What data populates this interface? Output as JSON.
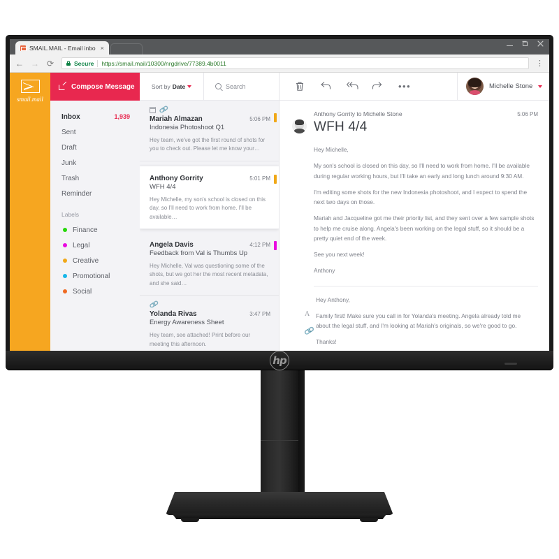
{
  "browser": {
    "tab_title": "SMAIL.MAIL - Email inbo",
    "tab_close": "×",
    "secure_label": "Secure",
    "url": "https://smail.mail/10300/nrgdrive/77389.4b0011",
    "back_icon": "←",
    "forward_icon": "→",
    "reload_icon": "⟳",
    "menu_icon": "⋮"
  },
  "brand": {
    "name": "smail.mail"
  },
  "nav": {
    "compose_label": "Compose Message",
    "items": [
      {
        "label": "Inbox",
        "count": "1,939",
        "active": true
      },
      {
        "label": "Sent",
        "count": "",
        "active": false
      },
      {
        "label": "Draft",
        "count": "",
        "active": false
      },
      {
        "label": "Junk",
        "count": "",
        "active": false
      },
      {
        "label": "Trash",
        "count": "",
        "active": false
      },
      {
        "label": "Reminder",
        "count": "",
        "active": false
      }
    ],
    "labels_header": "Labels",
    "labels": [
      {
        "label": "Finance",
        "color": "#27d70a"
      },
      {
        "label": "Legal",
        "color": "#e90ae0"
      },
      {
        "label": "Creative",
        "color": "#f0a818"
      },
      {
        "label": "Promotional",
        "color": "#17b6e8"
      },
      {
        "label": "Social",
        "color": "#ef6a22"
      }
    ]
  },
  "list_toolbar": {
    "sort_prefix": "Sort by ",
    "sort_value": "Date",
    "search_placeholder": "Search"
  },
  "emails": [
    {
      "sender": "Mariah Almazan",
      "time": "5:06 PM",
      "subject": "Indonesia Photoshoot Q1",
      "preview": "Hey team, we've got the first round of shots for you to check out. Please let me know your…",
      "flag": "#f0a818",
      "has_calendar": true,
      "has_attachment": true,
      "selected": false
    },
    {
      "sender": "Anthony Gorrity",
      "time": "5:01 PM",
      "subject": "WFH 4/4",
      "preview": "Hey Michelle, my son's school is closed on this day, so I'll need to work from home. I'll be available…",
      "flag": "#f0a818",
      "has_calendar": false,
      "has_attachment": false,
      "selected": true
    },
    {
      "sender": "Angela Davis",
      "time": "4:12 PM",
      "subject": "Feedback from Val is Thumbs Up",
      "preview": "Hey Michelle, Val was questioning some of the shots, but we got her the most recent metadata, and she said…",
      "flag": "#e90ae0",
      "has_calendar": false,
      "has_attachment": false,
      "selected": false
    },
    {
      "sender": "Yolanda Rivas",
      "time": "3:47 PM",
      "subject": "Energy Awareness Sheet",
      "preview": "Hey team, see attached! Print before our meeting this afternoon.",
      "flag": "",
      "has_calendar": false,
      "has_attachment": true,
      "selected": false
    }
  ],
  "read_toolbar": {
    "icons": [
      "trash-icon",
      "reply-icon",
      "reply-all-icon",
      "forward-icon",
      "more-icon"
    ],
    "more_glyph": "•••",
    "user_name": "Michelle Stone"
  },
  "message": {
    "from_to": "Anthony Gorrity to Michelle Stone",
    "time": "5:06 PM",
    "subject": "WFH 4/4",
    "paragraphs": [
      "Hey Michelle,",
      "My son's school is closed on this day, so I'll need to work from home. I'll be available during regular working hours, but I'll take an early and long lunch around 9:30 AM.",
      "I'm editing some shots for the new Indonesia photoshoot, and I expect to spend the next two days on those.",
      "Mariah and Jacqueline got me their priority list, and they sent over a few sample shots to help me cruise along. Angela's been working on the legal stuff, so it should be a pretty quiet end of the week.",
      "See you next week!",
      "Anthony"
    ]
  },
  "reply": {
    "format_icon": "A",
    "attach_icon": "🔗",
    "paragraphs": [
      "Hey Anthony,",
      "Family first! Make sure you call in for Yolanda's meeting. Angela already told me about the legal stuff, and I'm looking at Mariah's originals, so we're good to go.",
      "Thanks!"
    ]
  },
  "monitor": {
    "brand": "hp"
  }
}
